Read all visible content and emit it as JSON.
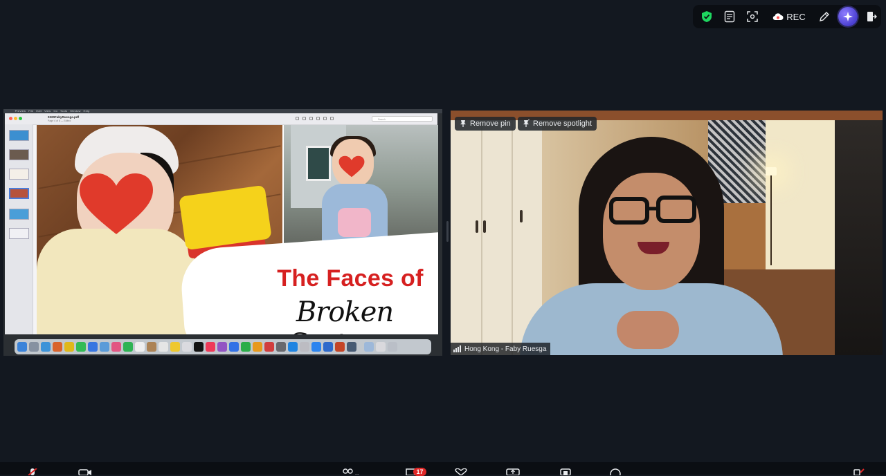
{
  "toolbar": {
    "rec_label": "REC",
    "icons": [
      "shield-check-icon",
      "notes-icon",
      "focus-icon",
      "cloud-record-icon",
      "annotate-icon",
      "ai-companion-icon",
      "leave-icon"
    ],
    "colors": {
      "shield": "#1ed760",
      "record_cloud": "#ff4d4d",
      "ai": "#6f63ff"
    }
  },
  "shared_screen": {
    "menubar": "  Preview   File   Edit   View   Go   Tools   Window   Help",
    "filename": "0320FabyRuesga.pdf",
    "page_info": "Page 4 of 6 — Edited",
    "search_placeholder": "Search",
    "slide": {
      "title": "The Faces of",
      "subtitle": "Broken Systems"
    }
  },
  "video": {
    "remove_pin_label": "Remove pin",
    "remove_spotlight_label": "Remove spotlight",
    "participant_name": "Hong Kong - Faby Ruesga"
  },
  "bottom_bar": {
    "chat_badge": "17"
  }
}
